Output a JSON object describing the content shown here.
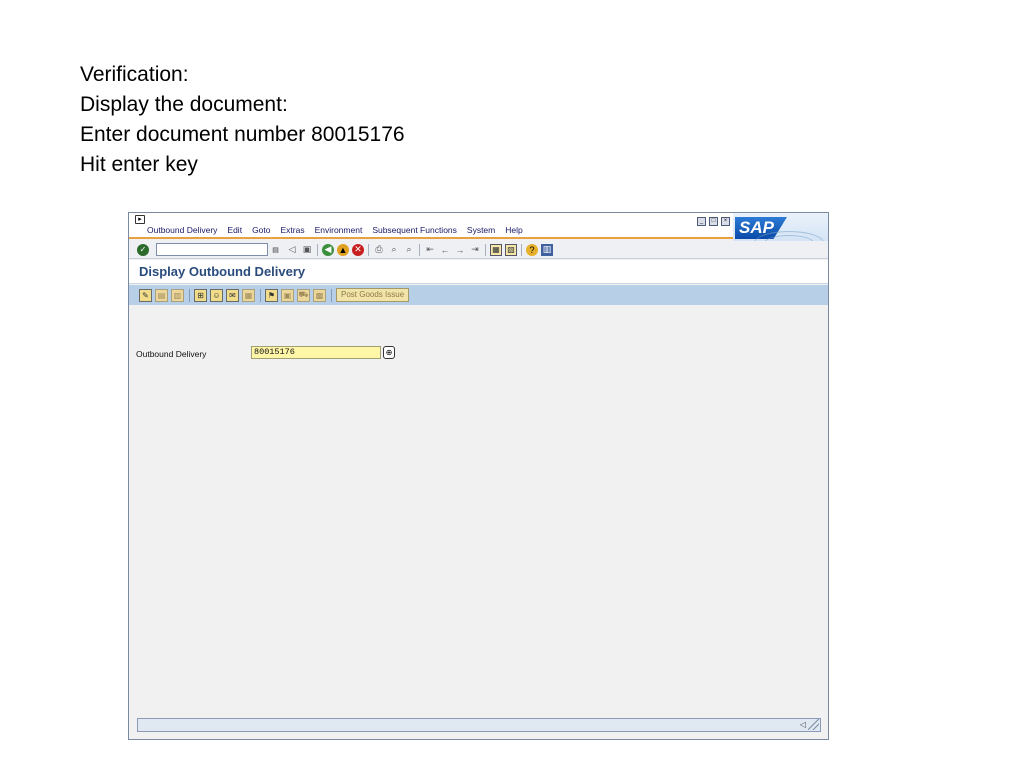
{
  "instructions": {
    "line1": "Verification:",
    "line2": "Display the document:",
    "line3": "Enter document number 80015176",
    "line4": "Hit enter key"
  },
  "menu": {
    "items": [
      {
        "label": "Outbound Delivery"
      },
      {
        "label": "Edit"
      },
      {
        "label": "Goto"
      },
      {
        "label": "Extras"
      },
      {
        "label": "Environment"
      },
      {
        "label": "Subsequent Functions"
      },
      {
        "label": "System"
      },
      {
        "label": "Help"
      }
    ]
  },
  "brand": {
    "logo": "SAP",
    "primary_color": "#0a4aa8",
    "accent_color": "#e8a040"
  },
  "page": {
    "title": "Display Outbound Delivery"
  },
  "app_toolbar": {
    "post_goods_issue": "Post Goods Issue"
  },
  "form": {
    "outbound_delivery_label": "Outbound Delivery",
    "outbound_delivery_value": "80015176"
  },
  "icons": {
    "enter": "check-icon",
    "back": "back-icon",
    "exit": "exit-icon",
    "cancel": "cancel-icon",
    "print": "print-icon",
    "find": "find-icon",
    "help": "help-icon",
    "layout": "layout-icon",
    "value_help": "value-help-icon"
  }
}
